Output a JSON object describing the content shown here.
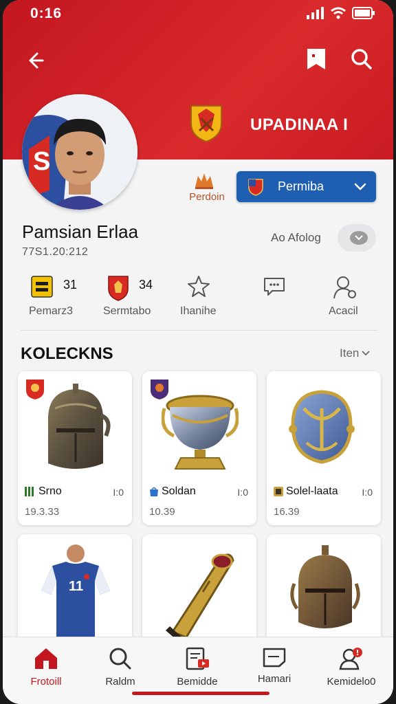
{
  "status": {
    "time": "0:16"
  },
  "header": {
    "back_icon": "back-arrow-icon",
    "bookmark_icon": "bookmark-icon",
    "search_icon": "search-icon",
    "team_name": "UPADINAA I",
    "accent": "#c3161f"
  },
  "player": {
    "name": "Pamsian Erlaa",
    "date": "77S1.20:212",
    "prediction_label": "Perdoin",
    "dropdown_value": "Permiba",
    "toggle_label": "Ao Afolog"
  },
  "stats": [
    {
      "value": "31",
      "label": "Pemarz3"
    },
    {
      "value": "34",
      "label": "Sermtabo"
    },
    {
      "value": "",
      "label": "Ihanihe"
    },
    {
      "value": "",
      "label": ""
    },
    {
      "value": "",
      "label": "Acacil"
    }
  ],
  "collection": {
    "title": "KOLECKNS",
    "filter_label": "Iten",
    "items": [
      {
        "name": "Srno",
        "qty": "I:0",
        "price": "19.3.33"
      },
      {
        "name": "Soldan",
        "qty": "I:0",
        "price": "10.39"
      },
      {
        "name": "Solel-laata",
        "qty": "I:0",
        "price": "16.39"
      },
      {
        "name": "",
        "qty": "",
        "price": ""
      },
      {
        "name": "",
        "qty": "",
        "price": ""
      },
      {
        "name": "",
        "qty": "",
        "price": ""
      }
    ]
  },
  "nav": [
    {
      "label": "Frotoill",
      "icon": "home-icon",
      "active": true
    },
    {
      "label": "Raldm",
      "icon": "search-icon"
    },
    {
      "label": "Bemidde",
      "icon": "media-icon"
    },
    {
      "label": "Hamari",
      "icon": "tag-icon"
    },
    {
      "label": "Kemidelo0",
      "icon": "profile-notification-icon"
    }
  ]
}
